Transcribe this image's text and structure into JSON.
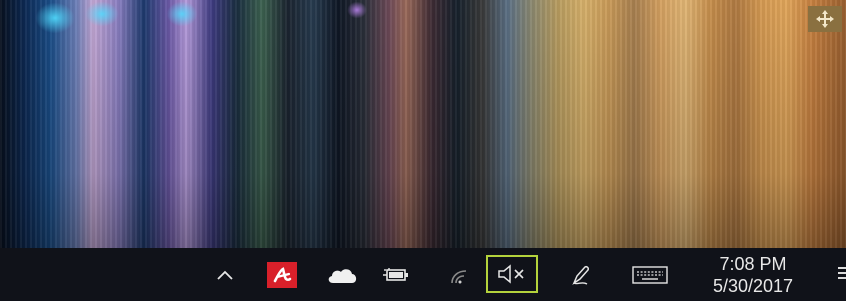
{
  "desktop": {
    "wallpaper": "abstract-colorful-reflections",
    "corner_icon": "move-arrows-icon"
  },
  "taskbar": {
    "tray_icons": [
      {
        "name": "show-hidden-icons",
        "icon": "chevron-up-icon"
      },
      {
        "name": "avira",
        "icon": "avira-icon",
        "color": "#d8202a"
      },
      {
        "name": "onedrive",
        "icon": "cloud-icon"
      },
      {
        "name": "power",
        "icon": "battery-charging-icon"
      },
      {
        "name": "network",
        "icon": "wifi-icon"
      },
      {
        "name": "volume",
        "icon": "speaker-muted-icon",
        "highlight_color": "#b4d23c"
      },
      {
        "name": "windows-ink",
        "icon": "pen-icon"
      },
      {
        "name": "touch-keyboard",
        "icon": "keyboard-icon"
      }
    ],
    "clock": {
      "time": "7:08 PM",
      "date": "5/30/2017"
    },
    "action_center_icon": "notifications-icon"
  }
}
